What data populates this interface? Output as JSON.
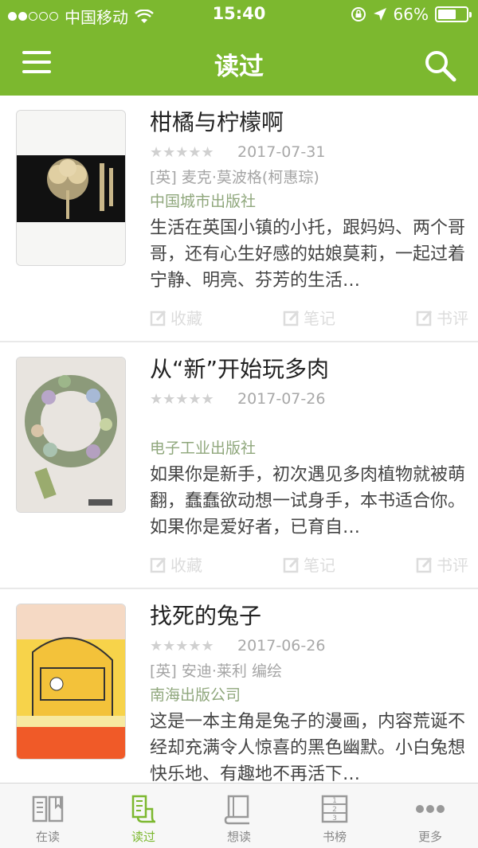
{
  "status_bar": {
    "carrier": "中国移动",
    "time": "15:40",
    "battery": "66%",
    "battery_level": 0.66
  },
  "nav": {
    "title": "读过"
  },
  "books": [
    {
      "title": "柑橘与柠檬啊",
      "rating": "★★★★★",
      "date": "2017-07-31",
      "author": "[英] 麦克·莫波格(柯惠琮)",
      "publisher": "中国城市出版社",
      "description": "生活在英国小镇的小托，跟妈妈、两个哥哥，还有心生好感的姑娘莫莉，一起过着宁静、明亮、芬芳的生活…",
      "actions": [
        "收藏",
        "笔记",
        "书评"
      ]
    },
    {
      "title": "从“新”开始玩多肉",
      "rating": "★★★★★",
      "date": "2017-07-26",
      "author": "",
      "publisher": "电子工业出版社",
      "description": "如果你是新手，初次遇见多肉植物就被萌翻，蠢蠢欲动想一试身手，本书适合你。如果你是爱好者，已育自…",
      "actions": [
        "收藏",
        "笔记",
        "书评"
      ]
    },
    {
      "title": "找死的兔子",
      "rating": "★★★★★",
      "date": "2017-06-26",
      "author": "[英] 安迪·莱利 编绘",
      "publisher": "南海出版公司",
      "description": "这是一本主角是兔子的漫画，内容荒诞不经却充满令人惊喜的黑色幽默。小白兔想快乐地、有趣地不再活下…",
      "actions": [
        "收藏",
        "笔记",
        "书评"
      ]
    }
  ],
  "tabs": [
    {
      "label": "在读",
      "icon": "open-book-icon"
    },
    {
      "label": "读过",
      "icon": "scroll-icon"
    },
    {
      "label": "想读",
      "icon": "books-icon"
    },
    {
      "label": "书榜",
      "icon": "ranking-icon"
    },
    {
      "label": "更多",
      "icon": "more-icon"
    }
  ],
  "colors": {
    "brand": "#7cb82f",
    "active_tab": "#7cb82f"
  }
}
